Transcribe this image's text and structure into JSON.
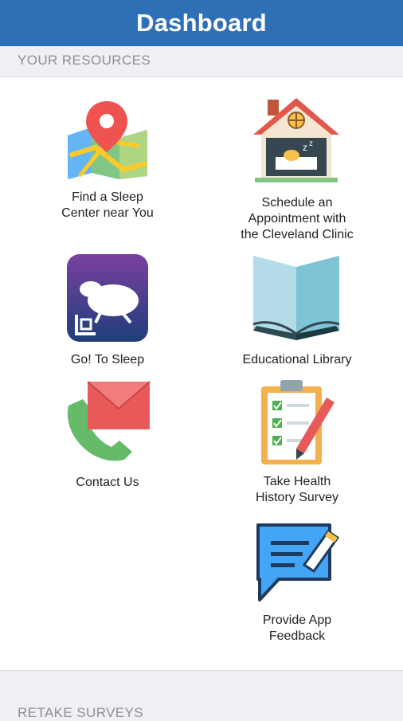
{
  "header": {
    "title": "Dashboard"
  },
  "sections": {
    "resources": "YOUR RESOURCES",
    "retake": "RETAKE SURVEYS"
  },
  "tiles": [
    {
      "label": "Find a Sleep\nCenter near You",
      "icon": "map-pin-icon"
    },
    {
      "label": "Schedule an\nAppointment with\nthe Cleveland Clinic",
      "icon": "house-sleep-icon"
    },
    {
      "label": "Go! To Sleep",
      "icon": "sheep-app-icon"
    },
    {
      "label": "Educational Library",
      "icon": "open-book-icon"
    },
    {
      "label": "Contact Us",
      "icon": "phone-envelope-icon"
    },
    {
      "label": "Take Health\nHistory Survey",
      "icon": "clipboard-checklist-icon"
    },
    {
      "label": "Provide App\nFeedback",
      "icon": "speech-bubble-pencil-icon"
    }
  ],
  "colors": {
    "header": "#2f6fb6",
    "background": "#efeff4",
    "panel": "#ffffff"
  }
}
